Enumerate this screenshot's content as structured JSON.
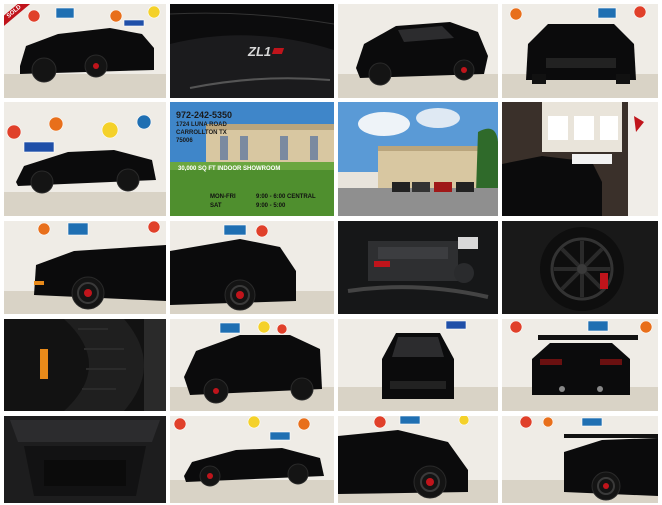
{
  "gallery": {
    "sold_badge": "SOLD",
    "signs": [
      "Gulf",
      "Mobiloil",
      "OK",
      "76",
      "Texaco",
      "Mobil"
    ],
    "flyer": {
      "phone": "972-242-5350",
      "address_line1": "1724 LUNA ROAD",
      "address_line2": "CARROLLTON TX",
      "zip": "75006",
      "showroom": "30,000 SQ FT INDOOR SHOWROOM",
      "hours_weekday_label": "MON-FRI",
      "hours_weekday": "9:00 - 6:00 CENTRAL",
      "hours_sat_label": "SAT",
      "hours_sat": "9:00 - 5:00"
    },
    "zl1_badge": "ZL1",
    "colors": {
      "body": "#0b0b0c",
      "caliper": "#c0141b",
      "sky": "#3f86c9",
      "grass": "#4f8f2e"
    }
  }
}
